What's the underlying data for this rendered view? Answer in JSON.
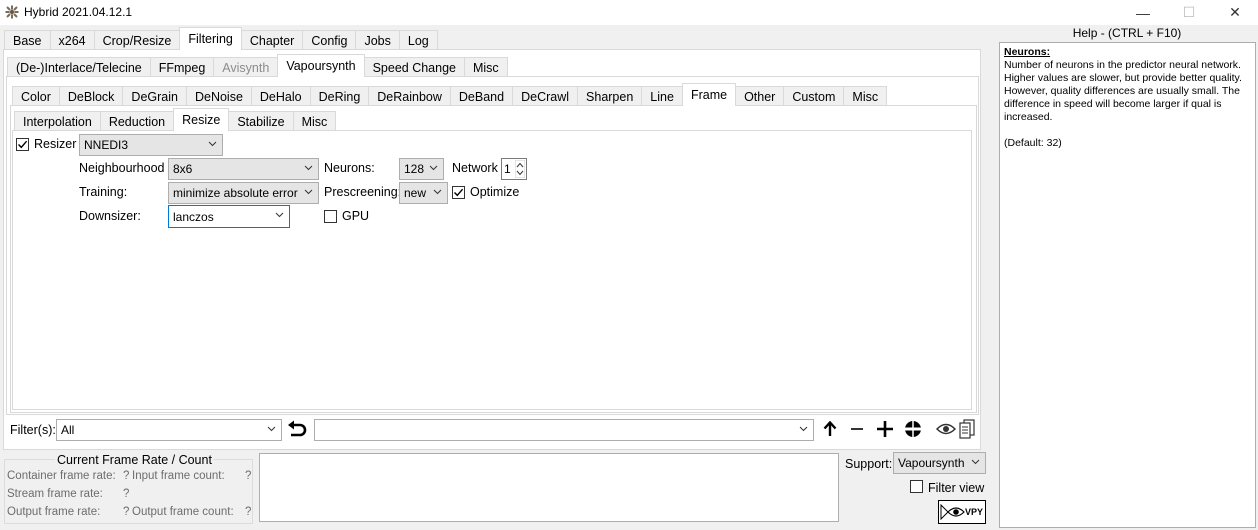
{
  "window": {
    "title": "Hybrid 2021.04.12.1",
    "minimize": "—",
    "maximize": "☐",
    "close": "✕"
  },
  "main_tabs": [
    "Base",
    "x264",
    "Crop/Resize",
    "Filtering",
    "Chapter",
    "Config",
    "Jobs",
    "Log"
  ],
  "main_tab_selected": "Filtering",
  "filter_tabs": [
    "(De-)Interlace/Telecine",
    "FFmpeg",
    "Avisynth",
    "Vapoursynth",
    "Speed Change",
    "Misc"
  ],
  "filter_tab_selected": "Vapoursynth",
  "vs_tabs": [
    "Color",
    "DeBlock",
    "DeGrain",
    "DeNoise",
    "DeHalo",
    "DeRing",
    "DeRainbow",
    "DeBand",
    "DeCrawl",
    "Sharpen",
    "Line",
    "Frame",
    "Other",
    "Custom",
    "Misc"
  ],
  "vs_tab_selected": "Frame",
  "frame_tabs": [
    "Interpolation",
    "Reduction",
    "Resize",
    "Stabilize",
    "Misc"
  ],
  "frame_tab_selected": "Resize",
  "resize": {
    "resizer_label": "Resizer",
    "resizer_checked": true,
    "resizer_value": "NNEDI3",
    "neighbourhood_label": "Neighbourhood",
    "neighbourhood_value": "8x6",
    "neurons_label": "Neurons:",
    "neurons_value": "128",
    "network_label": "Network",
    "network_value": "1",
    "training_label": "Training:",
    "training_value": "minimize absolute error",
    "prescreening_label": "Prescreening:",
    "prescreening_value": "new",
    "optimize_label": "Optimize",
    "optimize_checked": true,
    "downsizer_label": "Downsizer:",
    "downsizer_value": "lanczos",
    "gpu_label": "GPU",
    "gpu_checked": false
  },
  "filters_bar": {
    "label": "Filter(s):",
    "value": "All",
    "second_value": ""
  },
  "frame_rate": {
    "title": "Current Frame Rate / Count",
    "container_label": "Container frame rate:",
    "container_value": "?",
    "input_count_label": "Input frame count:",
    "input_count_value": "?",
    "stream_label": "Stream frame rate:",
    "stream_value": "?",
    "output_label": "Output frame rate:",
    "output_value": "?",
    "output_count_label": "Output frame count:",
    "output_count_value": "?"
  },
  "support": {
    "label": "Support:",
    "value": "Vapoursynth",
    "filter_view_label": "Filter view",
    "vpy_label": "VPY"
  },
  "help": {
    "title": "Help - (CTRL + F10)",
    "heading": "Neurons:",
    "line1": "Number of neurons in the predictor neural network.",
    "line2": "Higher values are slower, but provide better quality. However, quality differences are usually small. The difference in speed will become larger if qual is increased.",
    "line3": "(Default: 32)"
  }
}
